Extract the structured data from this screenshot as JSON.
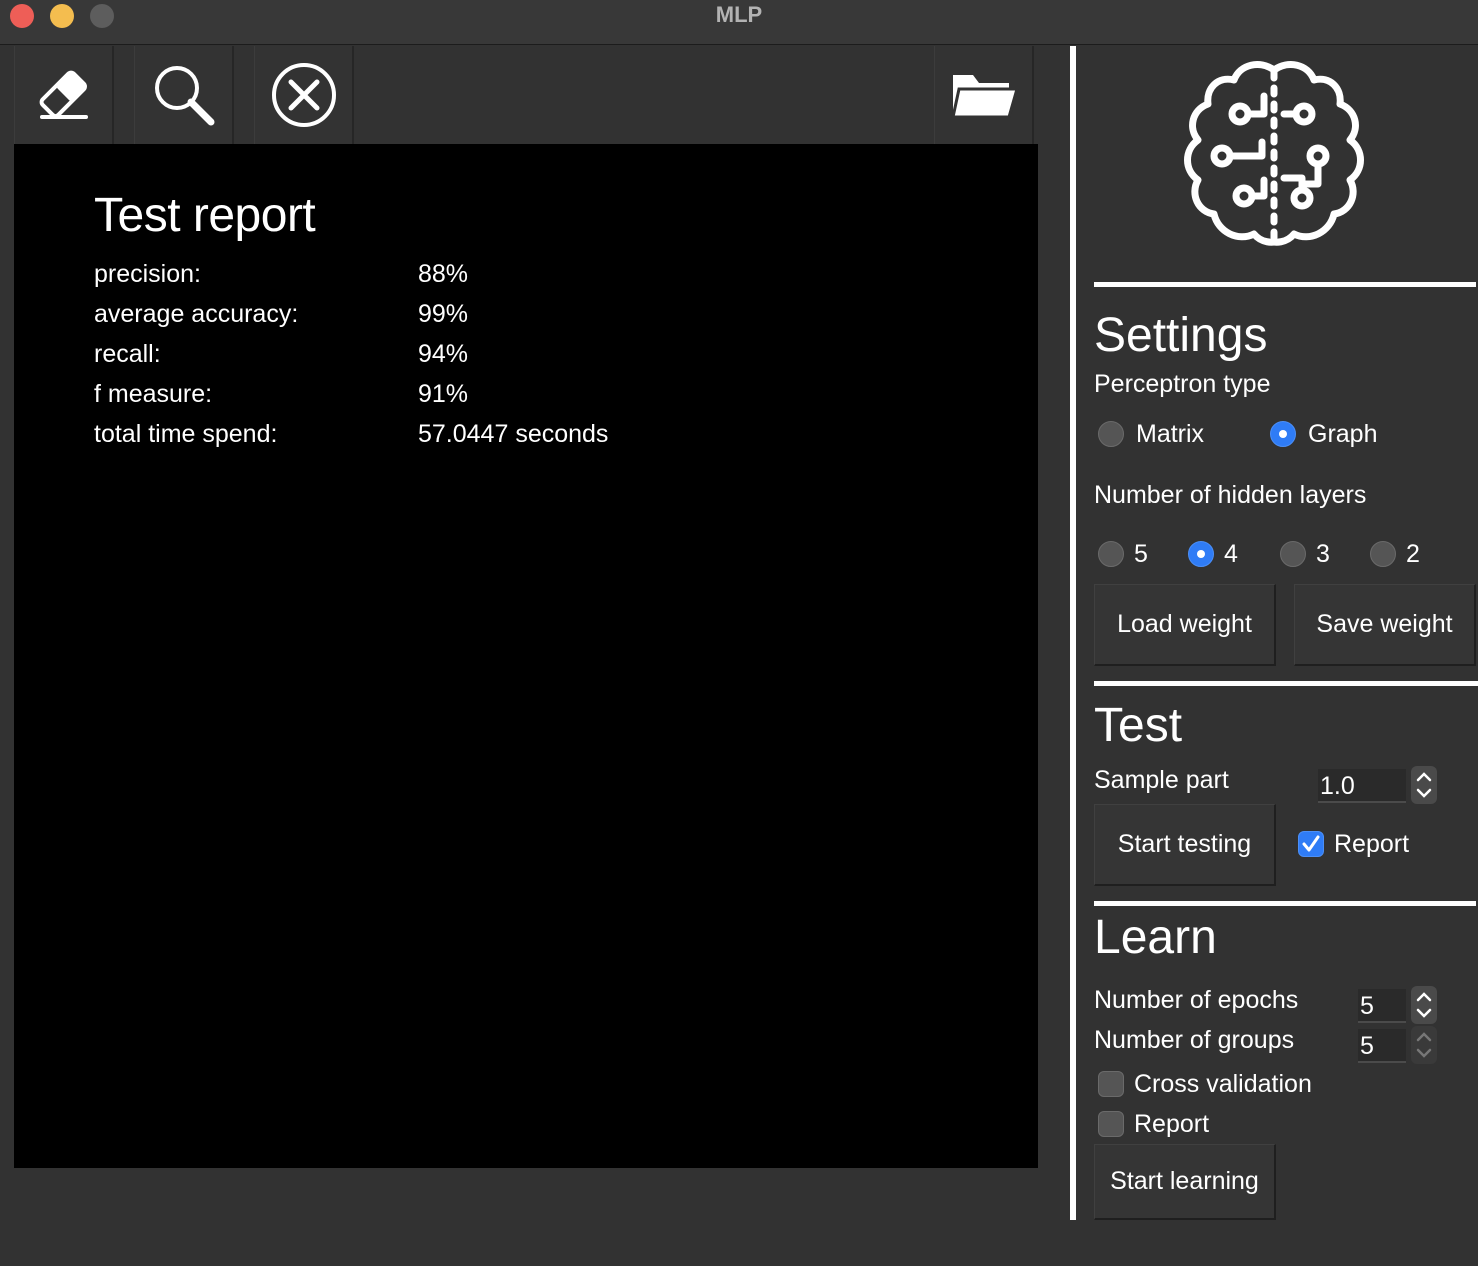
{
  "window": {
    "title": "MLP"
  },
  "toolbar": {
    "erase_icon": "eraser-icon",
    "search_icon": "search-icon",
    "clear_icon": "close-circle-icon",
    "open_icon": "folder-open-icon"
  },
  "report": {
    "title": "Test report",
    "rows": [
      {
        "label": "precision:",
        "value": "88%"
      },
      {
        "label": "average accuracy:",
        "value": "99%"
      },
      {
        "label": "recall:",
        "value": "94%"
      },
      {
        "label": "f measure:",
        "value": "91%"
      },
      {
        "label": "total time spend:",
        "value": "57.0447 seconds"
      }
    ]
  },
  "logo": {
    "icon": "brain-circuit-icon"
  },
  "settings": {
    "title": "Settings",
    "perceptron_label": "Perceptron type",
    "perceptron_options": [
      "Matrix",
      "Graph"
    ],
    "perceptron_selected": "Graph",
    "hidden_layers_label": "Number of hidden layers",
    "hidden_layers_options": [
      "5",
      "4",
      "3",
      "2"
    ],
    "hidden_layers_selected": "4",
    "load_weight": "Load weight",
    "save_weight": "Save weight"
  },
  "test": {
    "title": "Test",
    "sample_label": "Sample part",
    "sample_value": "1.0",
    "start_button": "Start testing",
    "report_label": "Report",
    "report_checked": true
  },
  "learn": {
    "title": "Learn",
    "epochs_label": "Number of epochs",
    "epochs_value": "5",
    "groups_label": "Number of groups",
    "groups_value": "5",
    "cross_validation_label": "Cross validation",
    "cross_validation_checked": false,
    "report_label": "Report",
    "report_checked": false,
    "start_button": "Start learning"
  },
  "colors": {
    "accent": "#2f7cf6",
    "background": "#323232",
    "canvas": "#000000"
  }
}
